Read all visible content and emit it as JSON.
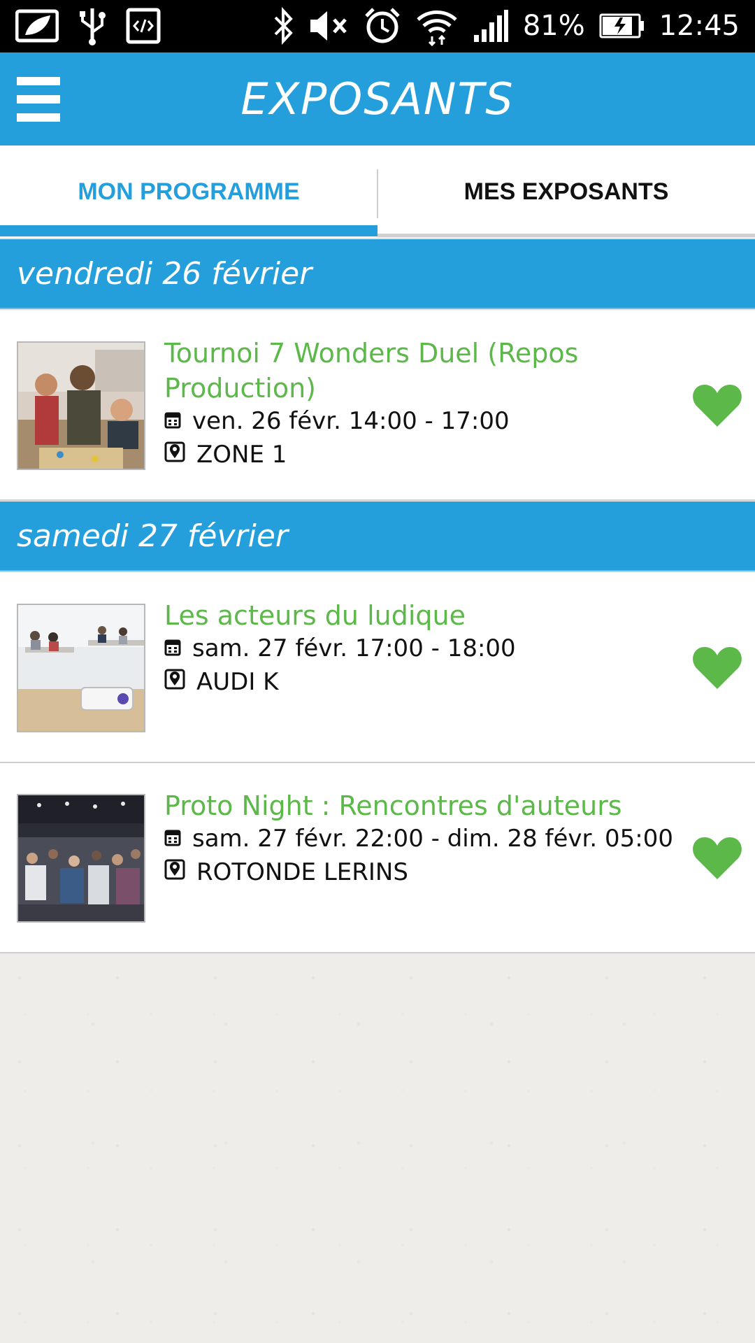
{
  "status_bar": {
    "battery": "81%",
    "time": "12:45",
    "icons": [
      "leaf-icon",
      "usb-icon",
      "code-icon",
      "bluetooth-icon",
      "mute-icon",
      "alarm-icon",
      "wifi-icon",
      "signal-icon",
      "battery-icon"
    ]
  },
  "app_bar": {
    "title": "EXPOSANTS",
    "menu_icon": "hamburger-menu-icon",
    "color": "#259fdc"
  },
  "tabs": [
    {
      "label": "MON PROGRAMME",
      "active": true
    },
    {
      "label": "MES EXPOSANTS",
      "active": false
    }
  ],
  "days": [
    {
      "label": "vendredi 26 février",
      "events": [
        {
          "title": "Tournoi 7 Wonders Duel (Repos Production)",
          "datetime": "ven. 26 févr. 14:00 - 17:00",
          "location": "ZONE 1",
          "favorite": true
        }
      ]
    },
    {
      "label": "samedi 27 février",
      "events": [
        {
          "title": "Les acteurs du ludique",
          "datetime": "sam. 27 févr. 17:00 - 18:00",
          "location": "AUDI K",
          "favorite": true
        },
        {
          "title": "Proto Night : Rencontres d'auteurs",
          "datetime": "sam. 27 févr. 22:00 - dim. 28 févr. 05:00",
          "location": "ROTONDE LERINS",
          "favorite": true
        }
      ]
    }
  ],
  "colors": {
    "accent": "#259fdc",
    "title_green": "#5db84a"
  }
}
